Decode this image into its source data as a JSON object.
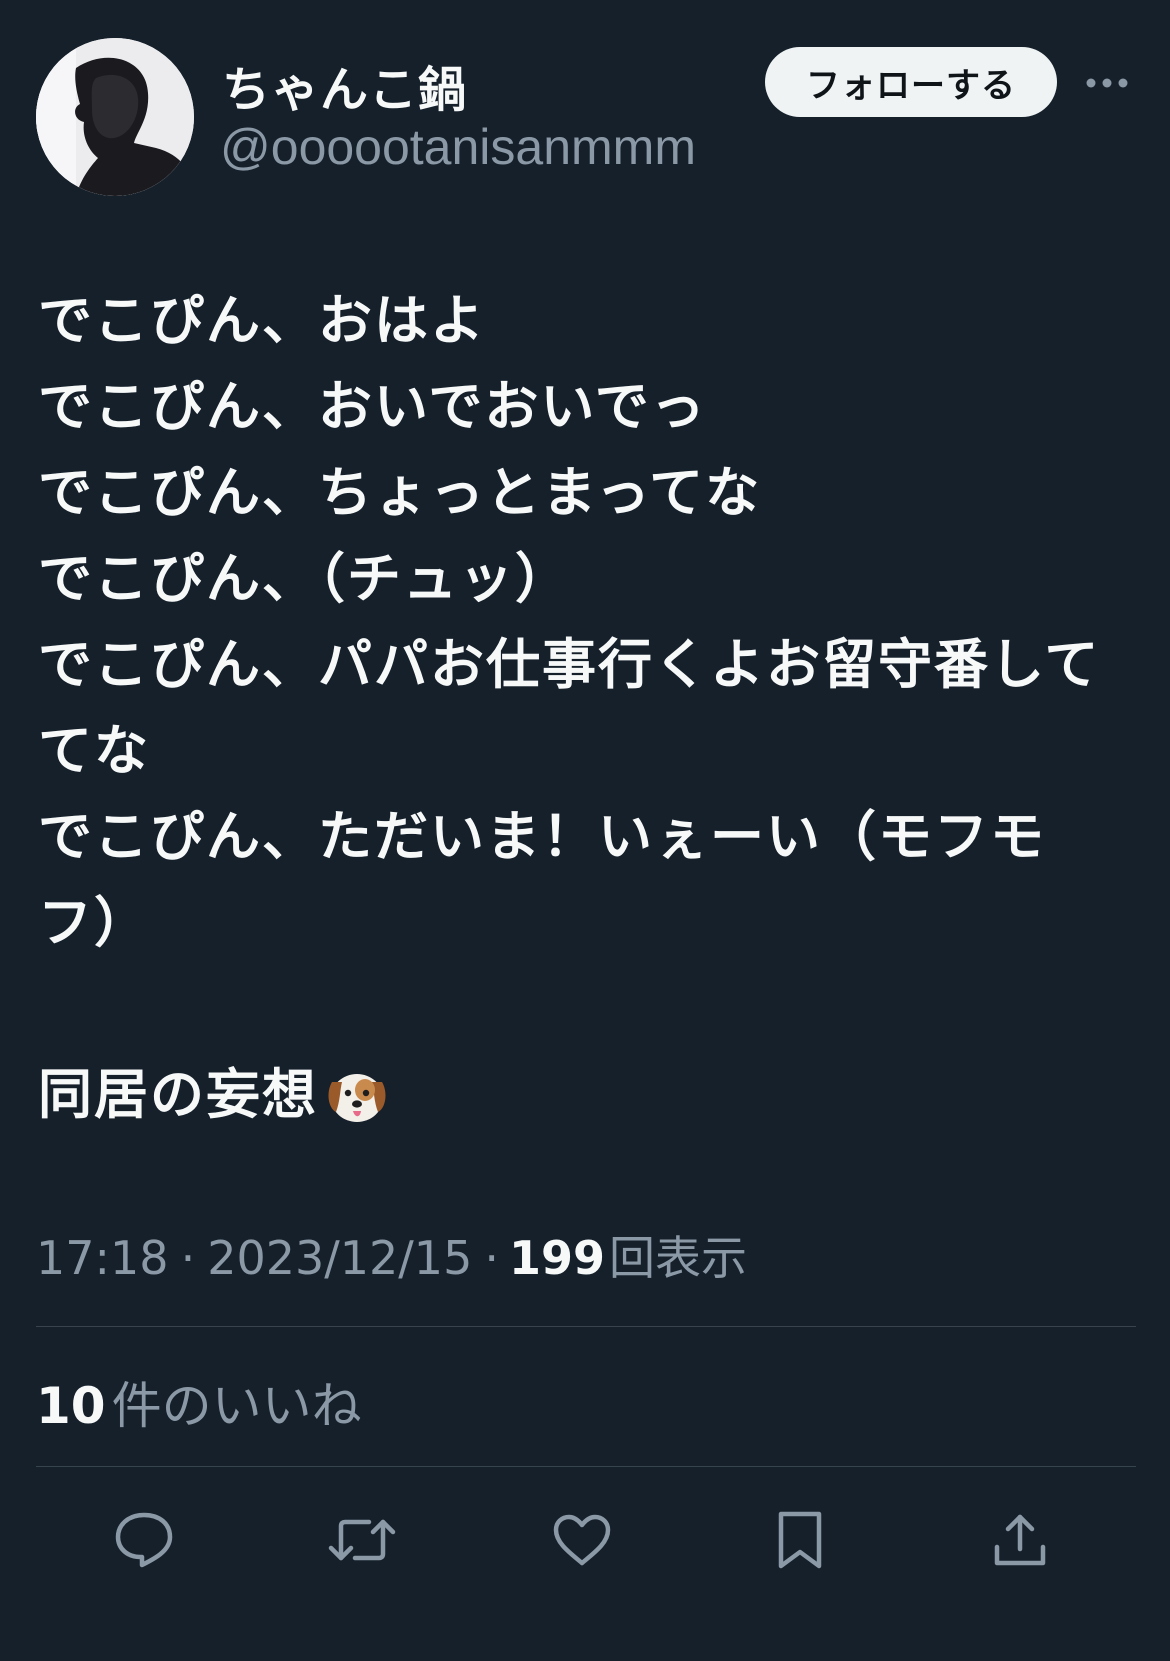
{
  "user": {
    "display_name": "ちゃんこ鍋",
    "handle": "@oooootanisanmmm"
  },
  "header": {
    "follow_label": "フォローする",
    "more_icon": "more-horizontal-icon"
  },
  "tweet": {
    "lines": [
      "でこぴん、おはよ",
      "でこぴん、おいでおいでっ",
      "でこぴん、ちょっとまってな",
      "でこぴん、（チュッ）",
      "でこぴん、パパお仕事行くよお留守番して",
      "てな",
      "でこぴん、ただいま！いぇーい（モフモ",
      "フ）"
    ],
    "last_line": "同居の妄想",
    "emoji": "dog-face-emoji"
  },
  "meta": {
    "time": "17:18",
    "separator": "·",
    "date": "2023/12/15",
    "views_count": "199",
    "views_label": "回表示"
  },
  "likes": {
    "count": "10",
    "label": "件のいいね"
  },
  "actions": {
    "reply_icon": "reply-icon",
    "retweet_icon": "retweet-icon",
    "like_icon": "heart-icon",
    "bookmark_icon": "bookmark-icon",
    "share_icon": "share-icon"
  },
  "colors": {
    "background": "#15202b",
    "text_primary": "#f7f9f9",
    "text_secondary": "#8b98a5",
    "divider": "#38444d",
    "follow_button_bg": "#eff3f4"
  }
}
